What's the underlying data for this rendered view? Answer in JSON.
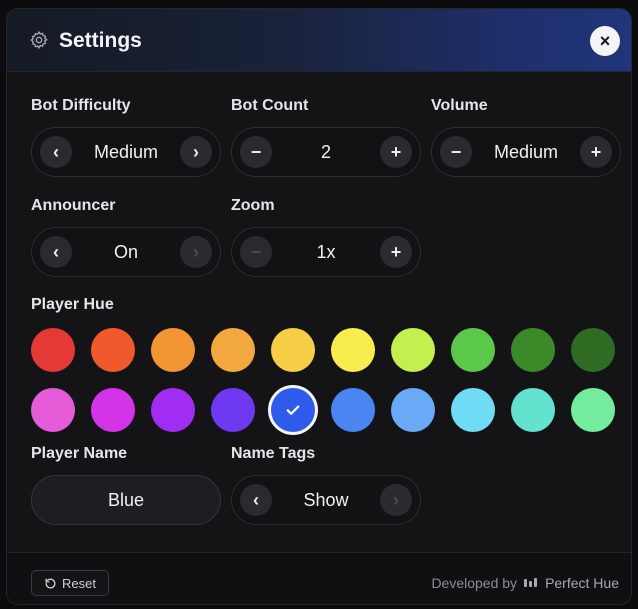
{
  "header": {
    "title": "Settings",
    "icon": "gear-icon",
    "close_icon": "close-icon"
  },
  "settings": {
    "bot_difficulty": {
      "label": "Bot Difficulty",
      "value": "Medium"
    },
    "bot_count": {
      "label": "Bot Count",
      "value": "2"
    },
    "volume": {
      "label": "Volume",
      "value": "Medium"
    },
    "announcer": {
      "label": "Announcer",
      "value": "On"
    },
    "zoom": {
      "label": "Zoom",
      "value": "1x"
    },
    "player_hue": {
      "label": "Player Hue",
      "selected_index": 14,
      "colors": [
        "#e53935",
        "#f0592b",
        "#f29633",
        "#f4a93e",
        "#f7cd46",
        "#f8ec4e",
        "#c3f04e",
        "#5cc84a",
        "#3a8a2a",
        "#2f6b22",
        "#e65bd8",
        "#d533e8",
        "#a22df2",
        "#6f39f2",
        "#2f5bea",
        "#4b85f2",
        "#6aa9f5",
        "#6fdbf5",
        "#62e2cf",
        "#74ec9d"
      ]
    },
    "player_name": {
      "label": "Player Name",
      "value": "Blue"
    },
    "name_tags": {
      "label": "Name Tags",
      "value": "Show"
    }
  },
  "footer": {
    "reset_label": "Reset",
    "developed_by": "Developed by",
    "brand": "Perfect Hue"
  }
}
